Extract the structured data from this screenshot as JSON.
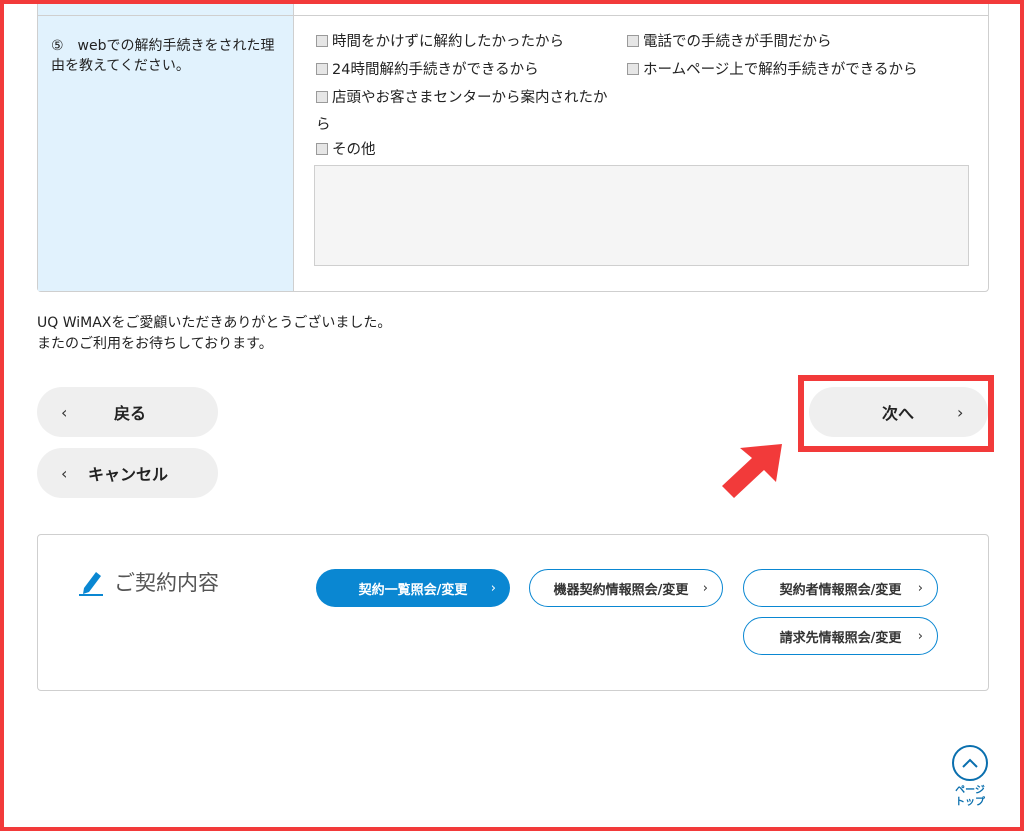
{
  "survey": {
    "question": "⑤　webでの解約手続きをされた理由を教えてください。",
    "options": [
      "時間をかけずに解約したかったから",
      "電話での手続きが手間だから",
      "24時間解約手続きができるから",
      "ホームページ上で解約手続きができるから",
      "店頭やお客さまセンターから案内されたから",
      "その他"
    ],
    "other_value": ""
  },
  "thanks": {
    "line1": "UQ WiMAXをご愛顧いただきありがとうございました。",
    "line2": "またのご利用をお待ちしております。"
  },
  "nav": {
    "back": "戻る",
    "cancel": "キャンセル",
    "next": "次へ",
    "chev_left": "‹",
    "chev_right": "›"
  },
  "contract": {
    "title": "ご契約内容",
    "buttons": [
      "契約一覧照会/変更",
      "機器契約情報照会/変更",
      "契約者情報照会/変更",
      "請求先情報照会/変更"
    ]
  },
  "page_top": "ページ\nトップ",
  "colors": {
    "accent": "#0a87d2",
    "highlight": "#f23a3a",
    "label_bg": "#e1f2fd"
  }
}
